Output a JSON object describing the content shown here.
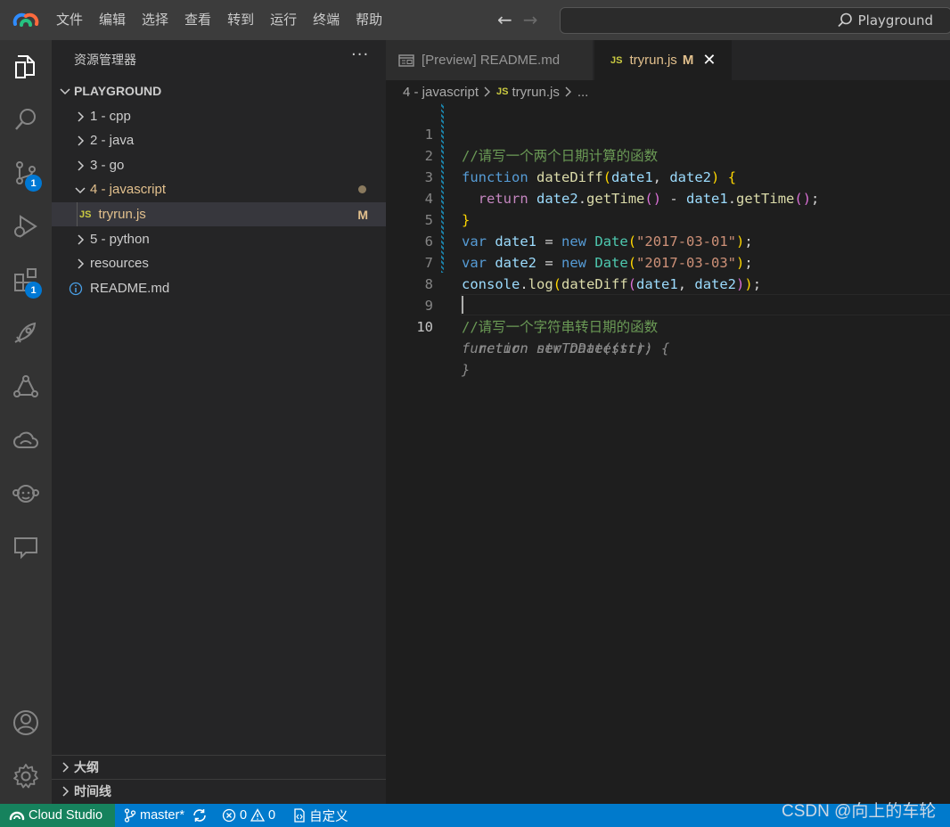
{
  "titlebar": {
    "menu": [
      "文件",
      "编辑",
      "选择",
      "查看",
      "转到",
      "运行",
      "终端",
      "帮助"
    ],
    "search_text": "Playground",
    "nav_back": "←",
    "nav_forward": "→"
  },
  "activitybar": {
    "items": [
      "explorer-icon",
      "search-icon",
      "source-control-icon",
      "run-debug-icon",
      "extensions-icon",
      "deploy-icon",
      "network-icon",
      "cloud-icon",
      "monkey-icon",
      "feedback-icon"
    ],
    "source_control_badge": "1",
    "extensions_badge": "1",
    "bottom": [
      "account-icon",
      "settings-icon"
    ]
  },
  "sidebar": {
    "title": "资源管理器",
    "more": "···",
    "workspace": "PLAYGROUND",
    "tree": [
      {
        "label": "1 - cpp",
        "type": "folder",
        "expanded": false
      },
      {
        "label": "2 - java",
        "type": "folder",
        "expanded": false
      },
      {
        "label": "3 - go",
        "type": "folder",
        "expanded": false
      },
      {
        "label": "4 - javascript",
        "type": "folder",
        "expanded": true
      },
      {
        "label": "tryrun.js",
        "type": "file",
        "icon": "JS",
        "status": "M"
      },
      {
        "label": "5 - python",
        "type": "folder",
        "expanded": false
      },
      {
        "label": "resources",
        "type": "folder",
        "expanded": false
      },
      {
        "label": "README.md",
        "type": "file",
        "icon": "info"
      }
    ],
    "outline": "大纲",
    "timeline": "时间线"
  },
  "tabs": [
    {
      "label": "[Preview] README.md",
      "active": false
    },
    {
      "label": "tryrun.js",
      "icon": "JS",
      "status": "M",
      "close": "✕",
      "active": true
    }
  ],
  "breadcrumb": [
    "4 - javascript",
    "tryrun.js",
    "..."
  ],
  "editor": {
    "line_numbers": [
      "1",
      "2",
      "3",
      "4",
      "5",
      "6",
      "7",
      "8",
      "9",
      "10"
    ],
    "lines": {
      "l1": "//请写一个两个日期计算的函数",
      "l2_kw": "function",
      "l2_fn": "dateDiff",
      "l2_p1": "date1",
      "l2_p2": "date2",
      "l3_kw": "return",
      "l3_v1": "date2",
      "l3_m1": "getTime",
      "l3_v2": "date1",
      "l3_m2": "getTime",
      "l5_kw": "var",
      "l5_v": "date1",
      "l5_new": "new",
      "l5_cls": "Date",
      "l5_str": "\"2017-03-01\"",
      "l6_kw": "var",
      "l6_v": "date2",
      "l6_new": "new",
      "l6_cls": "Date",
      "l6_str": "\"2017-03-03\"",
      "l7_obj": "console",
      "l7_fn": "log",
      "l7_fn2": "dateDiff",
      "l7_a1": "date1",
      "l7_a2": "date2",
      "l9": "//请写一个字符串转日期的函数",
      "ghost1": "function strToDate(str) {",
      "ghost2": "  return new Date(str);",
      "ghost3": "}"
    }
  },
  "statusbar": {
    "remote": "Cloud Studio",
    "branch": "master*",
    "errors": "0",
    "warnings": "0",
    "custom": "自定义"
  },
  "watermark": "CSDN @向上的车轮"
}
